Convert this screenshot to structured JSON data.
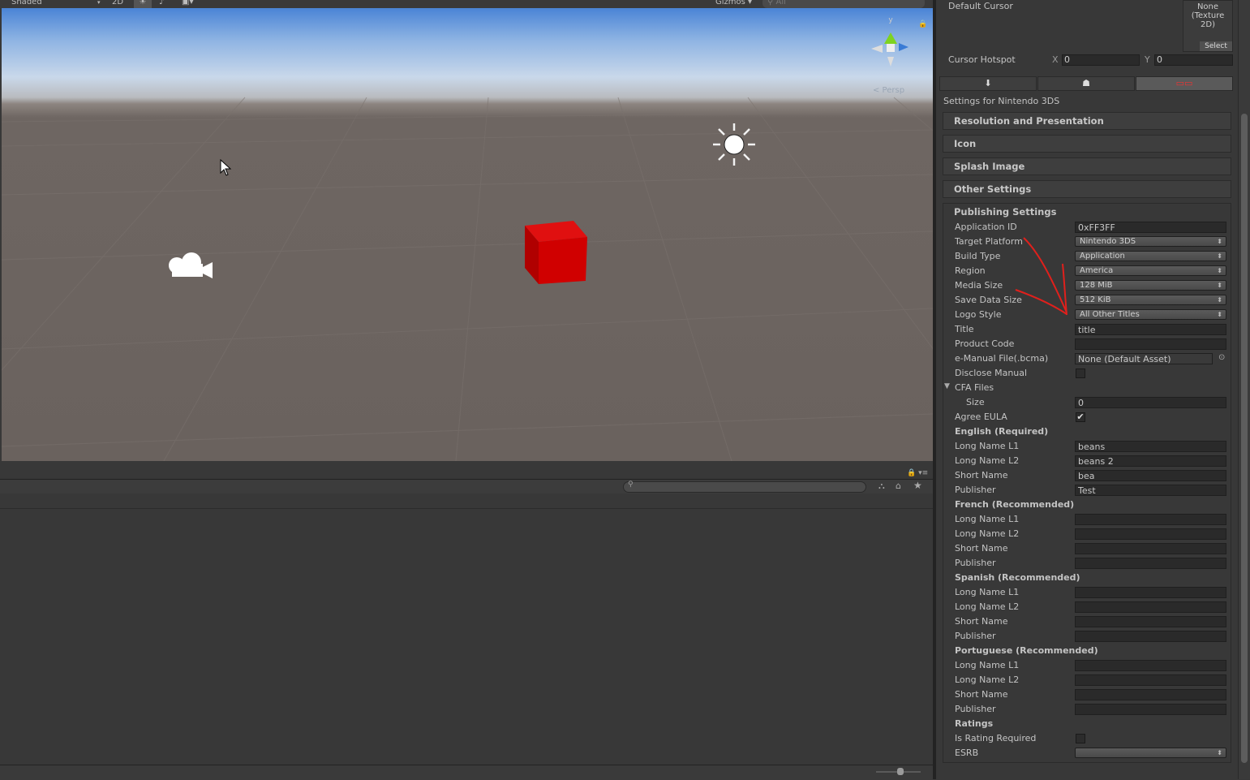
{
  "toolbar": {
    "shading_mode": "Shaded",
    "mode_2d": "2D",
    "sun_icon": "sun-icon",
    "audio_icon": "audio-icon",
    "effects_icon": "image-icon",
    "gizmos": "Gizmos",
    "search_placeholder": "All"
  },
  "scene": {
    "gizmo_axis_y": "y",
    "perspective": "< Persp",
    "objects": [
      "directional-light",
      "camera",
      "cube"
    ],
    "cube_color": "#cc0000"
  },
  "inspector": {
    "default_cursor_label": "Default Cursor",
    "cursor_texture": "None (Texture 2D)",
    "select_button": "Select",
    "cursor_hotspot_label": "Cursor Hotspot",
    "hotspot_x_label": "X",
    "hotspot_x": "0",
    "hotspot_y_label": "Y",
    "hotspot_y": "0",
    "platform_tabs": [
      "download-icon",
      "android-icon",
      "3ds-icon"
    ],
    "settings_for": "Settings for Nintendo 3DS",
    "sections": [
      "Resolution and Presentation",
      "Icon",
      "Splash Image",
      "Other Settings"
    ],
    "publishing_title": "Publishing Settings",
    "application_id_label": "Application ID",
    "application_id": "0xFF3FF",
    "target_platform_label": "Target Platform",
    "target_platform": "Nintendo 3DS",
    "build_type_label": "Build Type",
    "build_type": "Application",
    "region_label": "Region",
    "region": "America",
    "media_size_label": "Media Size",
    "media_size": "128 MiB",
    "save_data_size_label": "Save Data Size",
    "save_data_size": "512 KiB",
    "logo_style_label": "Logo Style",
    "logo_style": "All Other Titles",
    "title_label": "Title",
    "title": "title",
    "product_code_label": "Product Code",
    "product_code": "",
    "emanual_label": "e-Manual File(.bcma)",
    "emanual": "None (Default Asset)",
    "disclose_manual_label": "Disclose Manual",
    "disclose_manual": false,
    "cfa_files_label": "CFA Files",
    "size_label": "Size",
    "size": "0",
    "agree_eula_label": "Agree EULA",
    "agree_eula": true,
    "long_name_l1_label": "Long Name L1",
    "long_name_l2_label": "Long Name L2",
    "short_name_label": "Short Name",
    "publisher_label": "Publisher",
    "languages": [
      {
        "heading": "English (Required)",
        "long_name_l1": "beans",
        "long_name_l2": "beans 2",
        "short_name": "bea",
        "publisher": "Test"
      },
      {
        "heading": "French (Recommended)",
        "long_name_l1": "",
        "long_name_l2": "",
        "short_name": "",
        "publisher": ""
      },
      {
        "heading": "Spanish (Recommended)",
        "long_name_l1": "",
        "long_name_l2": "",
        "short_name": "",
        "publisher": ""
      },
      {
        "heading": "Portuguese (Recommended)",
        "long_name_l1": "",
        "long_name_l2": "",
        "short_name": "",
        "publisher": ""
      }
    ],
    "ratings_heading": "Ratings",
    "is_rating_required_label": "Is Rating Required",
    "is_rating_required": false,
    "esrb_label": "ESRB",
    "esrb": ""
  },
  "annotation_color": "#e0201c"
}
